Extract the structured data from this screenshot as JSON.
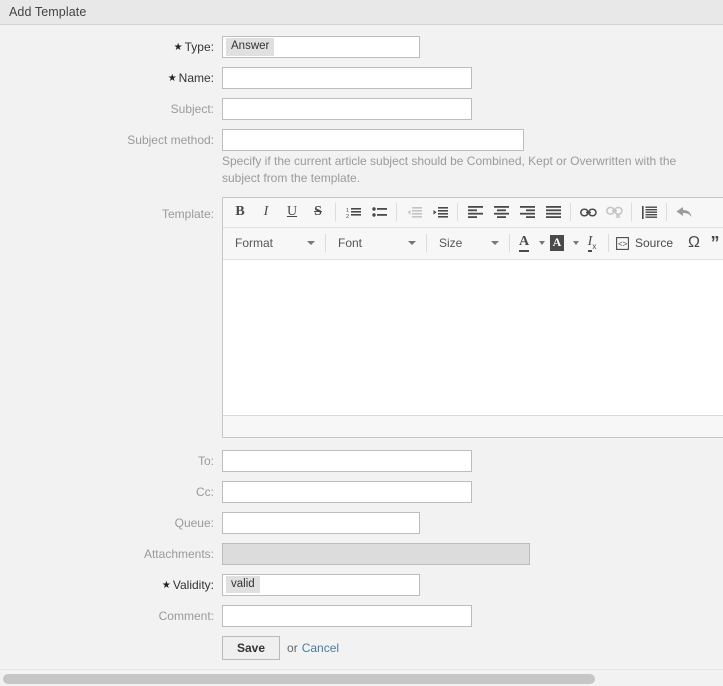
{
  "header": {
    "title": "Add Template"
  },
  "form": {
    "type": {
      "label": "Type:",
      "required": true,
      "value": "Answer"
    },
    "name": {
      "label": "Name:",
      "required": true,
      "value": ""
    },
    "subject": {
      "label": "Subject:",
      "required": false,
      "value": ""
    },
    "subject_method": {
      "label": "Subject method:",
      "required": false,
      "value": "",
      "help": "Specify if the current article subject should be Combined, Kept or Overwritten with the subject from the template."
    },
    "template": {
      "label": "Template:"
    },
    "to": {
      "label": "To:",
      "required": false,
      "value": ""
    },
    "cc": {
      "label": "Cc:",
      "required": false,
      "value": ""
    },
    "queue": {
      "label": "Queue:",
      "required": false,
      "value": ""
    },
    "attachments": {
      "label": "Attachments:",
      "required": false,
      "value": ""
    },
    "validity": {
      "label": "Validity:",
      "required": true,
      "value": "valid"
    },
    "comment": {
      "label": "Comment:",
      "required": false,
      "value": ""
    }
  },
  "editor": {
    "toolbar_row1": [
      {
        "name": "bold-icon",
        "glyph": "B",
        "enabled": true
      },
      {
        "name": "italic-icon",
        "glyph": "I",
        "enabled": true
      },
      {
        "name": "underline-icon",
        "glyph": "U",
        "enabled": true
      },
      {
        "name": "strikethrough-icon",
        "glyph": "S",
        "enabled": true
      },
      {
        "name": "numbered-list-icon",
        "enabled": true
      },
      {
        "name": "bulleted-list-icon",
        "enabled": true
      },
      {
        "name": "decrease-indent-icon",
        "enabled": false
      },
      {
        "name": "increase-indent-icon",
        "enabled": true
      },
      {
        "name": "align-left-icon",
        "enabled": true
      },
      {
        "name": "align-center-icon",
        "enabled": true
      },
      {
        "name": "align-right-icon",
        "enabled": true
      },
      {
        "name": "align-justify-icon",
        "enabled": true
      },
      {
        "name": "link-icon",
        "enabled": true
      },
      {
        "name": "unlink-icon",
        "enabled": false
      },
      {
        "name": "blockquote-icon",
        "enabled": true
      },
      {
        "name": "undo-icon",
        "enabled": true
      }
    ],
    "toolbar_row2": {
      "format_label": "Format",
      "font_label": "Font",
      "size_label": "Size",
      "text_color_label": "A",
      "bg_color_label": "A",
      "remove_format_label": "I",
      "source_label": "Source",
      "special_char_label": "Ω",
      "quote_label": "”"
    },
    "content": ""
  },
  "submit": {
    "save_label": "Save",
    "or_label": "or",
    "cancel_label": "Cancel"
  },
  "colors": {
    "page_bg": "#f2f2f2",
    "header_bg": "#e8e8e8",
    "link": "#4a7b9d",
    "label_muted": "#9a9a9a",
    "token_bg": "#e0e0e0"
  }
}
